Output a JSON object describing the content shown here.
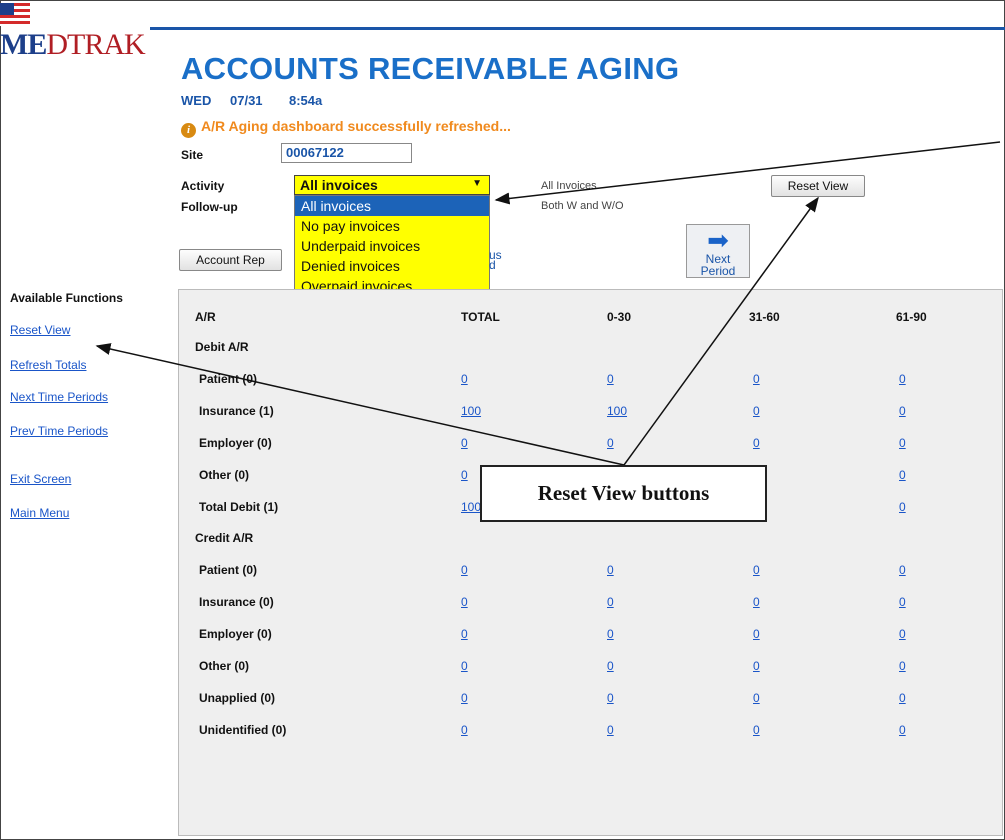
{
  "app": {
    "logo_text": "MEDTRAK"
  },
  "header": {
    "title": "ACCOUNTS RECEIVABLE AGING",
    "day": "WED",
    "date": "07/31",
    "time": "8:54a",
    "message": "A/R Aging dashboard successfully refreshed..."
  },
  "filters": {
    "site_label": "Site",
    "site_value": "00067122",
    "activity_label": "Activity",
    "activity_selected": "All invoices",
    "activity_options": [
      "All invoices",
      "No pay invoices",
      "Underpaid invoices",
      "Denied invoices",
      "Overpaid invoices"
    ],
    "activity_summary": "All Invoices",
    "followup_label": "Follow-up",
    "followup_summary": "Both W and W/O"
  },
  "buttons": {
    "reset_view": "Reset View",
    "account_rep": "Account Rep",
    "previous_period_partial": "us\nd",
    "next_period": "Next\nPeriod"
  },
  "sidebar": {
    "heading": "Available Functions",
    "items": [
      "Reset View",
      "Refresh Totals",
      "Next Time Periods",
      "Prev Time Periods",
      "Exit Screen",
      "Main Menu"
    ]
  },
  "table": {
    "headers": [
      "A/R",
      "TOTAL",
      "0-30",
      "31-60",
      "61-90"
    ],
    "debit_heading": "Debit A/R",
    "credit_heading": "Credit A/R",
    "debit_rows": [
      {
        "label": "Patient (0)",
        "values": [
          "0",
          "0",
          "0",
          "0"
        ]
      },
      {
        "label": "Insurance (1)",
        "values": [
          "100",
          "100",
          "0",
          "0"
        ]
      },
      {
        "label": "Employer (0)",
        "values": [
          "0",
          "0",
          "0",
          "0"
        ]
      },
      {
        "label": "Other (0)",
        "values": [
          "0",
          "",
          "",
          "0"
        ]
      },
      {
        "label": "Total Debit (1)",
        "values": [
          "100",
          "",
          "",
          "0"
        ]
      }
    ],
    "credit_rows": [
      {
        "label": "Patient (0)",
        "values": [
          "0",
          "0",
          "0",
          "0"
        ]
      },
      {
        "label": "Insurance (0)",
        "values": [
          "0",
          "0",
          "0",
          "0"
        ]
      },
      {
        "label": "Employer (0)",
        "values": [
          "0",
          "0",
          "0",
          "0"
        ]
      },
      {
        "label": "Other (0)",
        "values": [
          "0",
          "0",
          "0",
          "0"
        ]
      },
      {
        "label": "Unapplied (0)",
        "values": [
          "0",
          "0",
          "0",
          "0"
        ]
      },
      {
        "label": "Unidentified (0)",
        "values": [
          "0",
          "0",
          "0",
          "0"
        ]
      }
    ]
  },
  "callout": {
    "text": "Reset View buttons"
  }
}
